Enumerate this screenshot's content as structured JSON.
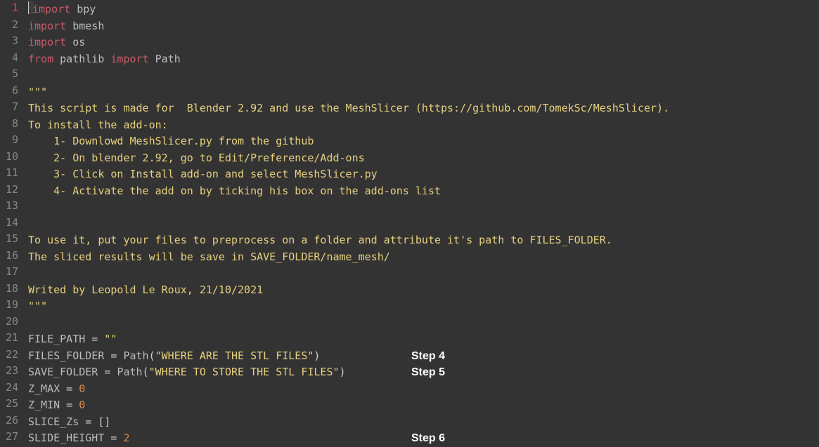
{
  "current_line": 1,
  "lines": [
    {
      "n": 1,
      "tokens": [
        {
          "cls": "kw",
          "t": "import"
        },
        {
          "cls": "op",
          "t": " "
        },
        {
          "cls": "mod",
          "t": "bpy"
        }
      ]
    },
    {
      "n": 2,
      "tokens": [
        {
          "cls": "kw",
          "t": "import"
        },
        {
          "cls": "op",
          "t": " "
        },
        {
          "cls": "mod",
          "t": "bmesh"
        }
      ]
    },
    {
      "n": 3,
      "tokens": [
        {
          "cls": "kw",
          "t": "import"
        },
        {
          "cls": "op",
          "t": " "
        },
        {
          "cls": "mod",
          "t": "os"
        }
      ]
    },
    {
      "n": 4,
      "tokens": [
        {
          "cls": "kw",
          "t": "from"
        },
        {
          "cls": "op",
          "t": " "
        },
        {
          "cls": "mod",
          "t": "pathlib"
        },
        {
          "cls": "op",
          "t": " "
        },
        {
          "cls": "kw",
          "t": "import"
        },
        {
          "cls": "op",
          "t": " "
        },
        {
          "cls": "mod",
          "t": "Path"
        }
      ]
    },
    {
      "n": 5,
      "tokens": []
    },
    {
      "n": 6,
      "tokens": [
        {
          "cls": "str",
          "t": "\"\"\""
        }
      ]
    },
    {
      "n": 7,
      "tokens": [
        {
          "cls": "str",
          "t": "This script is made for  Blender 2.92 and use the MeshSlicer (https://github.com/TomekSc/MeshSlicer)."
        }
      ]
    },
    {
      "n": 8,
      "tokens": [
        {
          "cls": "str",
          "t": "To install the add-on:"
        }
      ]
    },
    {
      "n": 9,
      "tokens": [
        {
          "cls": "str",
          "t": "    1- Downlowd MeshSlicer.py from the github"
        }
      ]
    },
    {
      "n": 10,
      "tokens": [
        {
          "cls": "str",
          "t": "    2- On blender 2.92, go to Edit/Preference/Add-ons"
        }
      ]
    },
    {
      "n": 11,
      "tokens": [
        {
          "cls": "str",
          "t": "    3- Click on Install add-on and select MeshSlicer.py"
        }
      ]
    },
    {
      "n": 12,
      "tokens": [
        {
          "cls": "str",
          "t": "    4- Activate the add on by ticking his box on the add-ons list"
        }
      ]
    },
    {
      "n": 13,
      "tokens": []
    },
    {
      "n": 14,
      "tokens": []
    },
    {
      "n": 15,
      "tokens": [
        {
          "cls": "str",
          "t": "To use it, put your files to preprocess on a folder and attribute it's path to FILES_FOLDER."
        }
      ]
    },
    {
      "n": 16,
      "tokens": [
        {
          "cls": "str",
          "t": "The sliced results will be save in SAVE_FOLDER/name_mesh/"
        }
      ]
    },
    {
      "n": 17,
      "tokens": []
    },
    {
      "n": 18,
      "tokens": [
        {
          "cls": "str",
          "t": "Writed by Leopold Le Roux, 21/10/2021"
        }
      ]
    },
    {
      "n": 19,
      "tokens": [
        {
          "cls": "str",
          "t": "\"\"\""
        }
      ]
    },
    {
      "n": 20,
      "tokens": []
    },
    {
      "n": 21,
      "tokens": [
        {
          "cls": "ident",
          "t": "FILE_PATH"
        },
        {
          "cls": "op",
          "t": " = "
        },
        {
          "cls": "str",
          "t": "\"\""
        }
      ]
    },
    {
      "n": 22,
      "tokens": [
        {
          "cls": "ident",
          "t": "FILES_FOLDER"
        },
        {
          "cls": "op",
          "t": " = "
        },
        {
          "cls": "ident",
          "t": "Path"
        },
        {
          "cls": "op",
          "t": "("
        },
        {
          "cls": "str",
          "t": "\"WHERE ARE THE STL FILES\""
        },
        {
          "cls": "op",
          "t": ")"
        }
      ]
    },
    {
      "n": 23,
      "tokens": [
        {
          "cls": "ident",
          "t": "SAVE_FOLDER"
        },
        {
          "cls": "op",
          "t": " = "
        },
        {
          "cls": "ident",
          "t": "Path"
        },
        {
          "cls": "op",
          "t": "("
        },
        {
          "cls": "str",
          "t": "\"WHERE TO STORE THE STL FILES\""
        },
        {
          "cls": "op",
          "t": ")"
        }
      ]
    },
    {
      "n": 24,
      "tokens": [
        {
          "cls": "ident",
          "t": "Z_MAX"
        },
        {
          "cls": "op",
          "t": " = "
        },
        {
          "cls": "num",
          "t": "0"
        }
      ]
    },
    {
      "n": 25,
      "tokens": [
        {
          "cls": "ident",
          "t": "Z_MIN"
        },
        {
          "cls": "op",
          "t": " = "
        },
        {
          "cls": "num",
          "t": "0"
        }
      ]
    },
    {
      "n": 26,
      "tokens": [
        {
          "cls": "ident",
          "t": "SLICE_Zs"
        },
        {
          "cls": "op",
          "t": " = []"
        }
      ]
    },
    {
      "n": 27,
      "tokens": [
        {
          "cls": "ident",
          "t": "SLIDE_HEIGHT"
        },
        {
          "cls": "op",
          "t": " = "
        },
        {
          "cls": "num",
          "t": "2"
        }
      ]
    }
  ],
  "annotations": [
    {
      "label": "Step 4",
      "line": 22
    },
    {
      "label": "Step 5",
      "line": 23
    },
    {
      "label": "Step 6",
      "line": 27
    }
  ]
}
